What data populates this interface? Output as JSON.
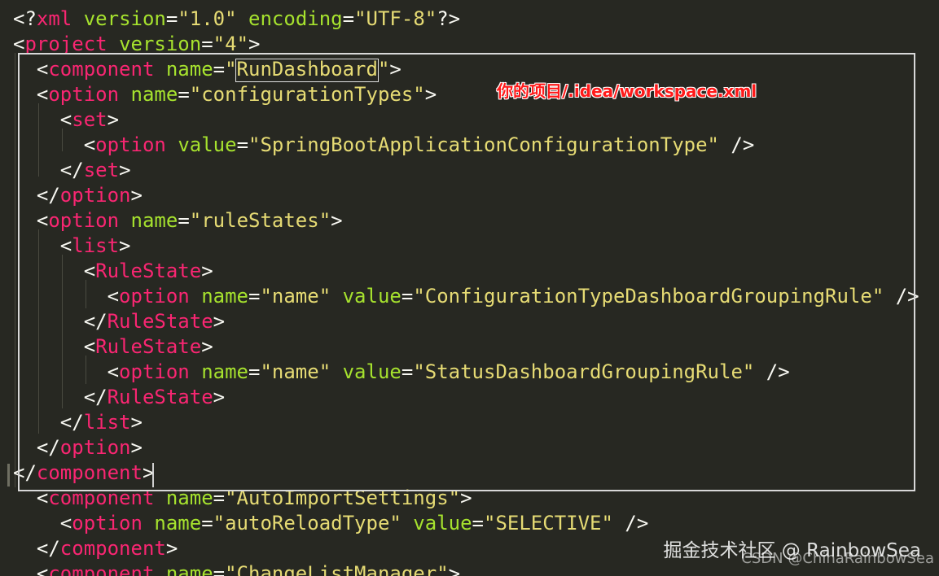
{
  "code_lines": [
    [
      {
        "t": "punct",
        "v": "<?"
      },
      {
        "t": "tag",
        "v": "xml"
      },
      {
        "t": "punct",
        "v": " "
      },
      {
        "t": "attr",
        "v": "version"
      },
      {
        "t": "punct",
        "v": "="
      },
      {
        "t": "str",
        "v": "\"1.0\""
      },
      {
        "t": "punct",
        "v": " "
      },
      {
        "t": "attr",
        "v": "encoding"
      },
      {
        "t": "punct",
        "v": "="
      },
      {
        "t": "str",
        "v": "\"UTF-8\""
      },
      {
        "t": "punct",
        "v": "?>"
      }
    ],
    [
      {
        "t": "punct",
        "v": "<"
      },
      {
        "t": "tag",
        "v": "project"
      },
      {
        "t": "punct",
        "v": " "
      },
      {
        "t": "attr",
        "v": "version"
      },
      {
        "t": "punct",
        "v": "="
      },
      {
        "t": "str",
        "v": "\"4\""
      },
      {
        "t": "punct",
        "v": ">"
      }
    ],
    [
      {
        "t": "punct",
        "v": "  <"
      },
      {
        "t": "tag",
        "v": "component"
      },
      {
        "t": "punct",
        "v": " "
      },
      {
        "t": "attr",
        "v": "name"
      },
      {
        "t": "punct",
        "v": "="
      },
      {
        "t": "str",
        "v": "\"RunDashboard\""
      },
      {
        "t": "punct",
        "v": ">"
      }
    ],
    [
      {
        "t": "punct",
        "v": "  <"
      },
      {
        "t": "tag",
        "v": "option"
      },
      {
        "t": "punct",
        "v": " "
      },
      {
        "t": "attr",
        "v": "name"
      },
      {
        "t": "punct",
        "v": "="
      },
      {
        "t": "str",
        "v": "\"configurationTypes\""
      },
      {
        "t": "punct",
        "v": ">"
      }
    ],
    [
      {
        "t": "punct",
        "v": "    <"
      },
      {
        "t": "tag",
        "v": "set"
      },
      {
        "t": "punct",
        "v": ">"
      }
    ],
    [
      {
        "t": "punct",
        "v": "      <"
      },
      {
        "t": "tag",
        "v": "option"
      },
      {
        "t": "punct",
        "v": " "
      },
      {
        "t": "attr",
        "v": "value"
      },
      {
        "t": "punct",
        "v": "="
      },
      {
        "t": "str",
        "v": "\"SpringBootApplicationConfigurationType\""
      },
      {
        "t": "punct",
        "v": " />"
      }
    ],
    [
      {
        "t": "punct",
        "v": "    </"
      },
      {
        "t": "tag",
        "v": "set"
      },
      {
        "t": "punct",
        "v": ">"
      }
    ],
    [
      {
        "t": "punct",
        "v": "  </"
      },
      {
        "t": "tag",
        "v": "option"
      },
      {
        "t": "punct",
        "v": ">"
      }
    ],
    [
      {
        "t": "punct",
        "v": "  <"
      },
      {
        "t": "tag",
        "v": "option"
      },
      {
        "t": "punct",
        "v": " "
      },
      {
        "t": "attr",
        "v": "name"
      },
      {
        "t": "punct",
        "v": "="
      },
      {
        "t": "str",
        "v": "\"ruleStates\""
      },
      {
        "t": "punct",
        "v": ">"
      }
    ],
    [
      {
        "t": "punct",
        "v": "    <"
      },
      {
        "t": "tag",
        "v": "list"
      },
      {
        "t": "punct",
        "v": ">"
      }
    ],
    [
      {
        "t": "punct",
        "v": "      <"
      },
      {
        "t": "tag",
        "v": "RuleState"
      },
      {
        "t": "punct",
        "v": ">"
      }
    ],
    [
      {
        "t": "punct",
        "v": "        <"
      },
      {
        "t": "tag",
        "v": "option"
      },
      {
        "t": "punct",
        "v": " "
      },
      {
        "t": "attr",
        "v": "name"
      },
      {
        "t": "punct",
        "v": "="
      },
      {
        "t": "str",
        "v": "\"name\""
      },
      {
        "t": "punct",
        "v": " "
      },
      {
        "t": "attr",
        "v": "value"
      },
      {
        "t": "punct",
        "v": "="
      },
      {
        "t": "str",
        "v": "\"ConfigurationTypeDashboardGroupingRule\""
      },
      {
        "t": "punct",
        "v": " />"
      }
    ],
    [
      {
        "t": "punct",
        "v": "      </"
      },
      {
        "t": "tag",
        "v": "RuleState"
      },
      {
        "t": "punct",
        "v": ">"
      }
    ],
    [
      {
        "t": "punct",
        "v": "      <"
      },
      {
        "t": "tag",
        "v": "RuleState"
      },
      {
        "t": "punct",
        "v": ">"
      }
    ],
    [
      {
        "t": "punct",
        "v": "        <"
      },
      {
        "t": "tag",
        "v": "option"
      },
      {
        "t": "punct",
        "v": " "
      },
      {
        "t": "attr",
        "v": "name"
      },
      {
        "t": "punct",
        "v": "="
      },
      {
        "t": "str",
        "v": "\"name\""
      },
      {
        "t": "punct",
        "v": " "
      },
      {
        "t": "attr",
        "v": "value"
      },
      {
        "t": "punct",
        "v": "="
      },
      {
        "t": "str",
        "v": "\"StatusDashboardGroupingRule\""
      },
      {
        "t": "punct",
        "v": " />"
      }
    ],
    [
      {
        "t": "punct",
        "v": "      </"
      },
      {
        "t": "tag",
        "v": "RuleState"
      },
      {
        "t": "punct",
        "v": ">"
      }
    ],
    [
      {
        "t": "punct",
        "v": "    </"
      },
      {
        "t": "tag",
        "v": "list"
      },
      {
        "t": "punct",
        "v": ">"
      }
    ],
    [
      {
        "t": "punct",
        "v": "  </"
      },
      {
        "t": "tag",
        "v": "option"
      },
      {
        "t": "punct",
        "v": ">"
      }
    ],
    [
      {
        "t": "punct",
        "v": "</"
      },
      {
        "t": "tag",
        "v": "component"
      },
      {
        "t": "punct",
        "v": ">"
      }
    ],
    [
      {
        "t": "punct",
        "v": "  <"
      },
      {
        "t": "tag",
        "v": "component"
      },
      {
        "t": "punct",
        "v": " "
      },
      {
        "t": "attr",
        "v": "name"
      },
      {
        "t": "punct",
        "v": "="
      },
      {
        "t": "str",
        "v": "\"AutoImportSettings\""
      },
      {
        "t": "punct",
        "v": ">"
      }
    ],
    [
      {
        "t": "punct",
        "v": "    <"
      },
      {
        "t": "tag",
        "v": "option"
      },
      {
        "t": "punct",
        "v": " "
      },
      {
        "t": "attr",
        "v": "name"
      },
      {
        "t": "punct",
        "v": "="
      },
      {
        "t": "str",
        "v": "\"autoReloadType\""
      },
      {
        "t": "punct",
        "v": " "
      },
      {
        "t": "attr",
        "v": "value"
      },
      {
        "t": "punct",
        "v": "="
      },
      {
        "t": "str",
        "v": "\"SELECTIVE\""
      },
      {
        "t": "punct",
        "v": " />"
      }
    ],
    [
      {
        "t": "punct",
        "v": "  </"
      },
      {
        "t": "tag",
        "v": "component"
      },
      {
        "t": "punct",
        "v": ">"
      }
    ],
    [
      {
        "t": "punct",
        "v": "  <"
      },
      {
        "t": "tag",
        "v": "component"
      },
      {
        "t": "punct",
        "v": " "
      },
      {
        "t": "attr",
        "v": "name"
      },
      {
        "t": "punct",
        "v": "="
      },
      {
        "t": "str",
        "v": "\"ChangeListManager\""
      },
      {
        "t": "punct",
        "v": ">"
      }
    ]
  ],
  "annotation": "你的项目/.idea/workspace.xml",
  "watermark": "掘金技术社区 @ RainbowSea",
  "watermark_sub": "CSDN @ChinaRainbowSea",
  "colors": {
    "background": "#272822",
    "tag": "#F92672",
    "attribute": "#A6E22E",
    "string": "#E6DB74",
    "punctuation": "#F8F8F2",
    "annotation": "#FF1A1A"
  }
}
